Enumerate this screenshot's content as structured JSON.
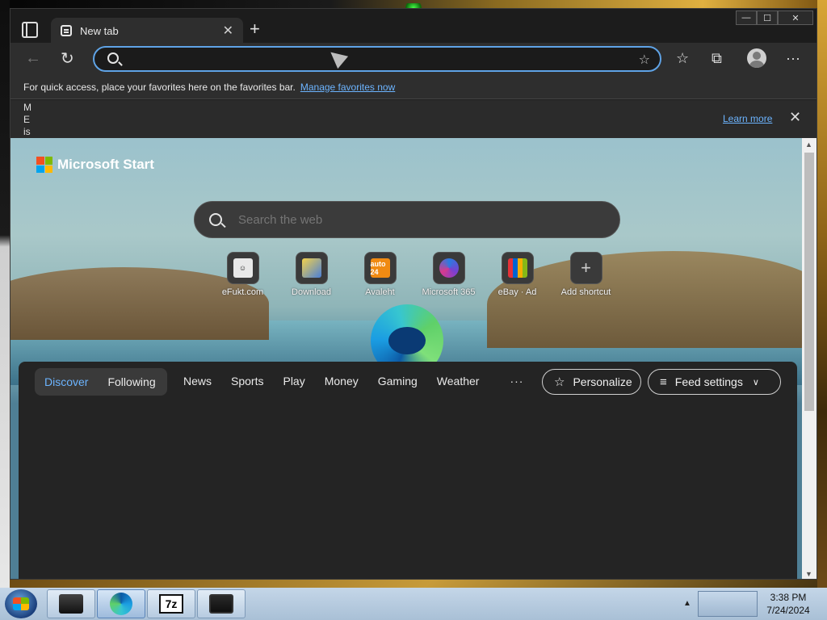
{
  "window": {
    "controls": [
      "—",
      "☐",
      "✕"
    ]
  },
  "tab": {
    "title": "New tab",
    "close": "✕",
    "new": "+"
  },
  "toolbar": {
    "back": "←",
    "refresh": "↻",
    "address_value": "",
    "add_favorite": "☆",
    "favorites": "☆",
    "collections": "⧉",
    "more": "···"
  },
  "favorites_bar": {
    "message": "For quick access, place your favorites here on the favorites bar.",
    "link": "Manage favorites now"
  },
  "notice": {
    "text": "M E is",
    "learn_more": "Learn more",
    "close": "✕"
  },
  "page": {
    "brand": "Microsoft Start",
    "search_placeholder": "Search the web",
    "shortcuts": [
      {
        "label": "eFukt.com",
        "icon": "face-thumbnail"
      },
      {
        "label": "Download",
        "icon": "download-thumbnail"
      },
      {
        "label": "Avaleht",
        "icon": "auto24",
        "icon_text": "auto 24"
      },
      {
        "label": "Microsoft 365",
        "icon": "m365-logo"
      },
      {
        "label": "eBay · Ad",
        "icon": "ebay-bag"
      },
      {
        "label": "Add shortcut",
        "icon": "plus"
      }
    ]
  },
  "feed": {
    "toggle": [
      "Discover",
      "Following"
    ],
    "nav": [
      "News",
      "Sports",
      "Play",
      "Money",
      "Gaming",
      "Weather"
    ],
    "more": "···",
    "personalize": "Personalize",
    "feed_settings": "Feed settings"
  },
  "scrollbar": {
    "up": "▲",
    "down": "▼"
  },
  "taskbar": {
    "tray_arrow": "▲",
    "time": "3:38 PM",
    "date": "7/24/2024"
  },
  "colors": {
    "accent": "#6cb4ff",
    "address_border": "#5fa3e6"
  }
}
